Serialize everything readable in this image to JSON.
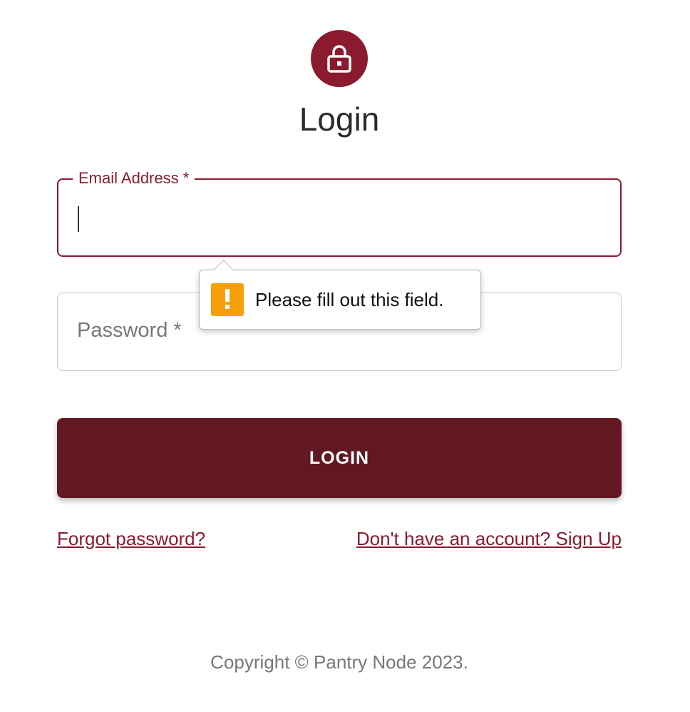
{
  "header": {
    "icon": "lock-icon",
    "title": "Login"
  },
  "form": {
    "email": {
      "label": "Email Address *",
      "value": ""
    },
    "password": {
      "placeholder": "Password *",
      "value": ""
    },
    "submit_label": "LOGIN"
  },
  "validation": {
    "icon": "warning-icon",
    "message": "Please fill out this field."
  },
  "links": {
    "forgot": "Forgot password?",
    "signup": "Don't have an account? Sign Up"
  },
  "footer": {
    "copyright": "Copyright © Pantry Node 2023."
  },
  "colors": {
    "primary": "#8b1a2f",
    "button": "#621822",
    "warning": "#f5a00b"
  }
}
